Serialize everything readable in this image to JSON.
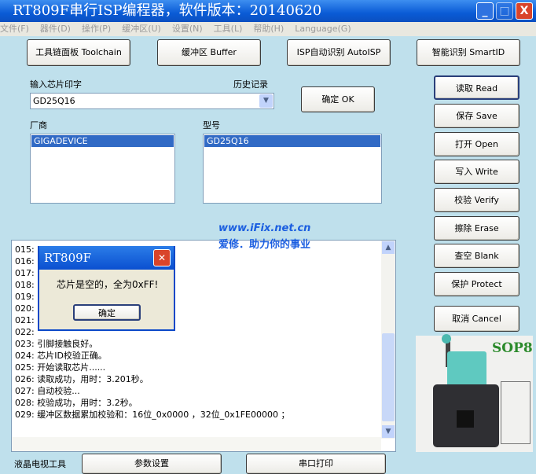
{
  "window": {
    "title": "RT809F串行ISP编程器，软件版本：20140620",
    "minimize": "_",
    "maximize": "□",
    "close": "X"
  },
  "menu": [
    "文件(F)",
    "器件(D)",
    "操作(P)",
    "缓冲区(U)",
    "设置(N)",
    "工具(L)",
    "帮助(H)",
    "Language(G)"
  ],
  "top_buttons": [
    "工具链面板 Toolchain",
    "缓冲区 Buffer",
    "ISP自动识别 AutoISP",
    "智能识别 SmartID"
  ],
  "chip_input": {
    "label": "输入芯片印字",
    "history_label": "历史记录",
    "value": "GD25Q16",
    "ok_button": "确定 OK"
  },
  "vendor": {
    "label": "厂商",
    "items": [
      "GIGADEVICE"
    ]
  },
  "model": {
    "label": "型号",
    "items": [
      "GD25Q16"
    ]
  },
  "watermark": {
    "url": "www.iFix.net.cn",
    "slogan": "爱修．助力你的事业"
  },
  "log": {
    "lines": [
      "015:",
      "016:",
      "017:",
      "018:",
      "019:",
      "020:",
      "021:",
      "022:",
      "023: 引脚接触良好。",
      "024: 芯片ID校验正确。",
      "025: 开始读取芯片......",
      "026: 读取成功，用时：3.201秒。",
      "027: 自动校验...",
      "028: 校验成功，用时：3.2秒。",
      "029: 缓冲区数据累加校验和：16位_0x0000 ，32位_0x1FE00000 ；"
    ]
  },
  "dialog": {
    "title": "RT809F",
    "message": "芯片是空的，全为0xFF!",
    "ok": "确定"
  },
  "right_buttons": [
    "读取 Read",
    "保存 Save",
    "打开 Open",
    "写入 Write",
    "校验 Verify",
    "擦除 Erase",
    "查空 Blank",
    "保护 Protect",
    "取消 Cancel"
  ],
  "socket_image": {
    "label": "SOP8"
  },
  "bottom": {
    "label": "液晶电视工具",
    "params_button": "参数设置",
    "serial_button": "串口打印"
  },
  "colors": {
    "background": "#bfe0ec",
    "titlebar": "#0a5bd6",
    "selection": "#316ac5"
  }
}
